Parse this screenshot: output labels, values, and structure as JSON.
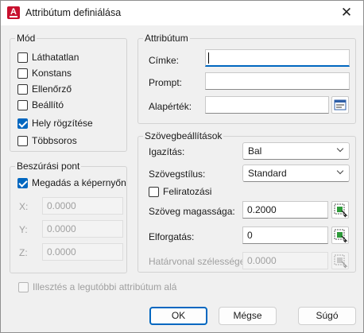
{
  "window": {
    "title": "Attribútum definiálása"
  },
  "mode": {
    "legend": "Mód",
    "items": [
      {
        "label": "Láthatatlan",
        "checked": false
      },
      {
        "label": "Konstans",
        "checked": false
      },
      {
        "label": "Ellenőrző",
        "checked": false
      },
      {
        "label": "Beállító",
        "checked": false
      },
      {
        "label": "Hely rögzítése",
        "checked": true
      },
      {
        "label": "Többsoros",
        "checked": false
      }
    ]
  },
  "insertion": {
    "legend": "Beszúrási pont",
    "specify_on_screen": {
      "label": "Megadás a képernyőn",
      "checked": true
    },
    "x": {
      "label": "X:",
      "value": "0.0000"
    },
    "y": {
      "label": "Y:",
      "value": "0.0000"
    },
    "z": {
      "label": "Z:",
      "value": "0.0000"
    }
  },
  "attribute": {
    "legend": "Attribútum",
    "tag": {
      "label": "Címke:",
      "value": ""
    },
    "prompt": {
      "label": "Prompt:",
      "value": ""
    },
    "default": {
      "label": "Alapérték:",
      "value": ""
    }
  },
  "text_settings": {
    "legend": "Szövegbeállítások",
    "justification": {
      "label": "Igazítás:",
      "value": "Bal"
    },
    "text_style": {
      "label": "Szövegstílus:",
      "value": "Standard"
    },
    "annotative": {
      "label": "Feliratozási",
      "checked": false
    },
    "text_height": {
      "label": "Szöveg magassága:",
      "value": "0.2000"
    },
    "rotation": {
      "label": "Elforgatás:",
      "value": "0"
    },
    "boundary_width": {
      "label": "Határvonal szélessége:",
      "value": "0.0000"
    }
  },
  "align_below": {
    "label": "Illesztés a legutóbbi attribútum alá",
    "checked": false
  },
  "buttons": {
    "ok": "OK",
    "cancel": "Mégse",
    "help": "Súgó"
  },
  "icons": [
    "autocad-app-icon",
    "close-icon",
    "insert-field-icon",
    "pick-point-icon"
  ],
  "colors": {
    "accent": "#0067c0",
    "app_icon": "#c8102e"
  }
}
